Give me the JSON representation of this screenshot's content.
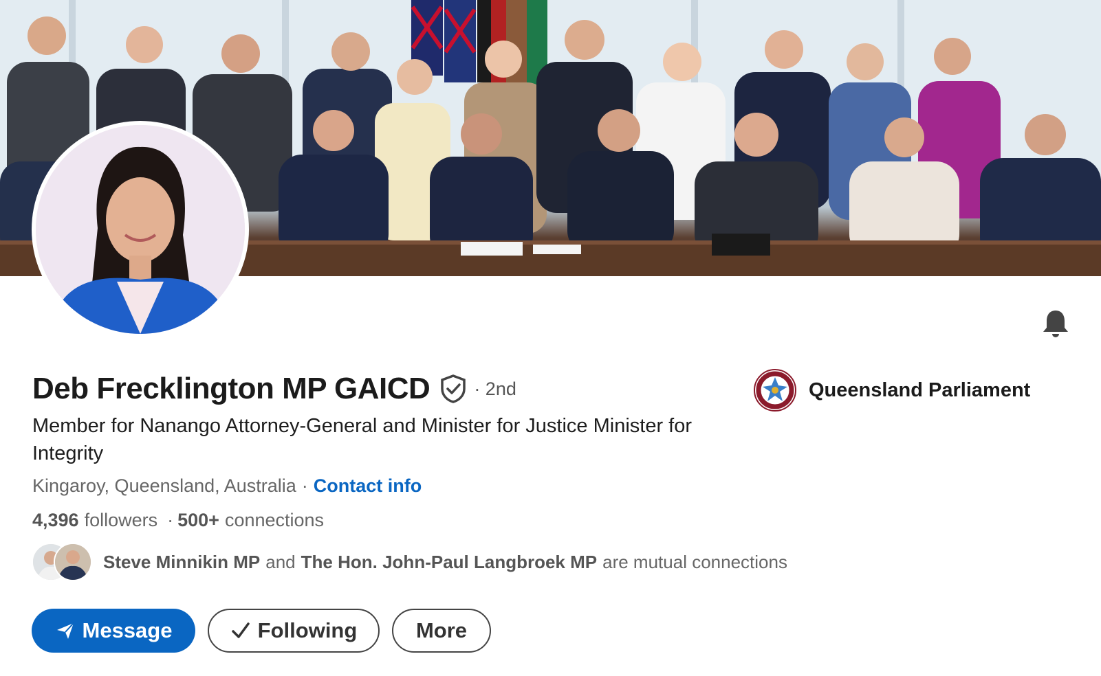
{
  "profile": {
    "name": "Deb Frecklington MP GAICD",
    "degree": "· 2nd",
    "headline": "Member for Nanango Attorney-General and Minister for Justice Minister for Integrity",
    "location": "Kingaroy, Queensland, Australia",
    "location_separator": "·",
    "contact_info_label": "Contact info",
    "followers_count": "4,396",
    "followers_label": "followers",
    "connections_separator": "·",
    "connections_count": "500+",
    "connections_label": "connections"
  },
  "mutual": {
    "first": "Steve Minnikin MP",
    "joiner": "and",
    "second": "The Hon. John-Paul Langbroek MP",
    "suffix": "are mutual connections"
  },
  "actions": {
    "message_label": "Message",
    "following_label": "Following",
    "more_label": "More"
  },
  "company": {
    "name": "Queensland Parliament"
  },
  "icons": {
    "verified": "verified-shield-icon",
    "bell": "bell-icon",
    "send": "send-icon",
    "check": "check-icon"
  },
  "colors": {
    "accent": "#0a66c2",
    "text_primary": "#1b1b1b",
    "text_secondary": "#666666",
    "company_logo": "#8b1a2b"
  }
}
